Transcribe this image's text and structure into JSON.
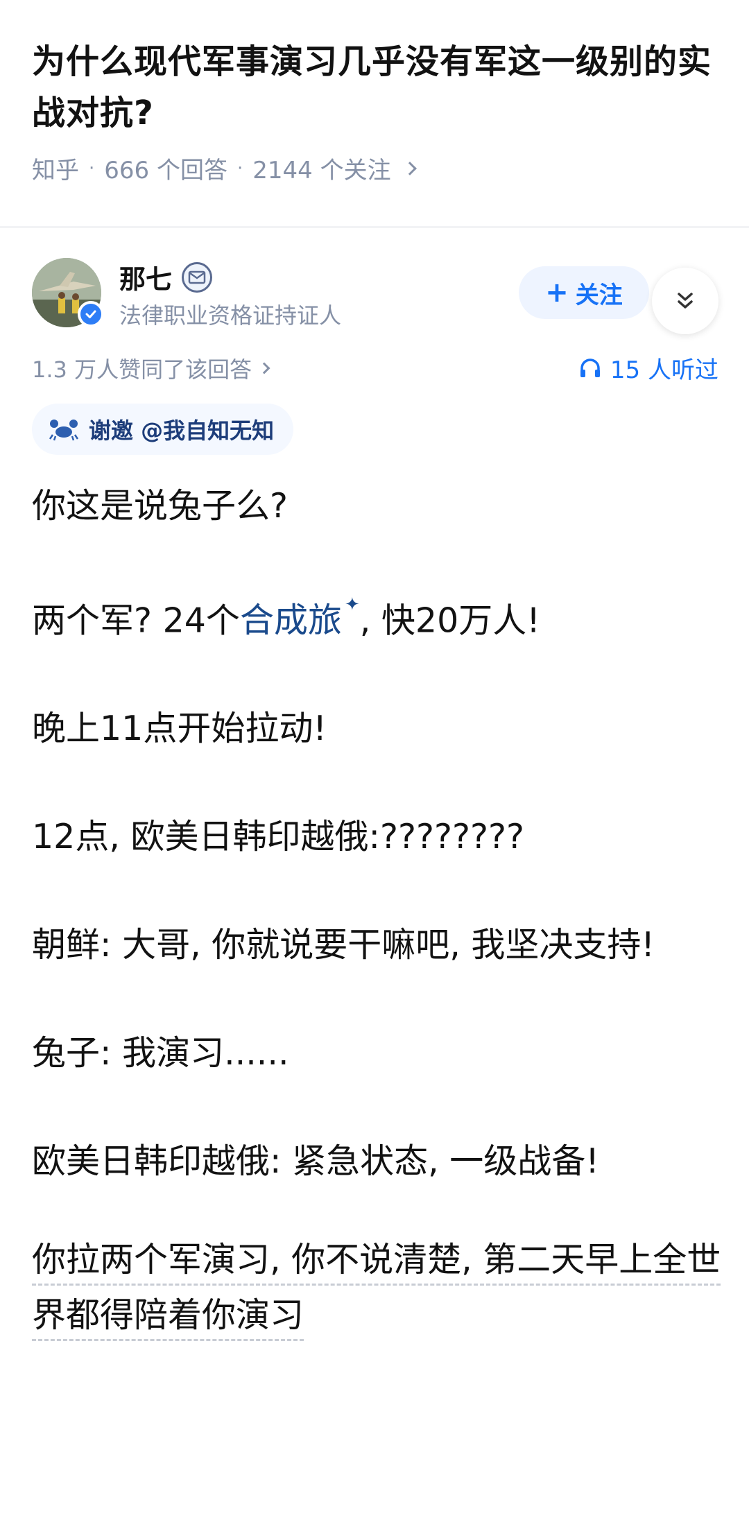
{
  "question": {
    "title": "为什么现代军事演习几乎没有军这一级别的实战对抗?",
    "source": "知乎",
    "answers": "666 个回答",
    "followers": "2144 个关注"
  },
  "author": {
    "name": "那七",
    "description": "法律职业资格证持证人",
    "follow_label": "关注",
    "likes_text": "1.3 万人赞同了该回答",
    "listened_text": "15 人听过",
    "invite_text": "谢邀 @我自知无知"
  },
  "content": {
    "p1": "你这是说兔子么?",
    "p2_before": "两个军? 24个",
    "p2_link": "合成旅",
    "p2_after": ", 快20万人!",
    "p3": "晚上11点开始拉动!",
    "p4": "12点, 欧美日韩印越俄:????????",
    "p5": "朝鲜: 大哥, 你就说要干嘛吧, 我坚决支持!",
    "p6": "兔子: 我演习......",
    "p7": "欧美日韩印越俄: 紧急状态, 一级战备!",
    "p8": "你拉两个军演习, 你不说清楚, 第二天早上全世界都得陪着你演习"
  },
  "icons": {
    "link_mark": "✦",
    "accent": "#1772f6"
  }
}
